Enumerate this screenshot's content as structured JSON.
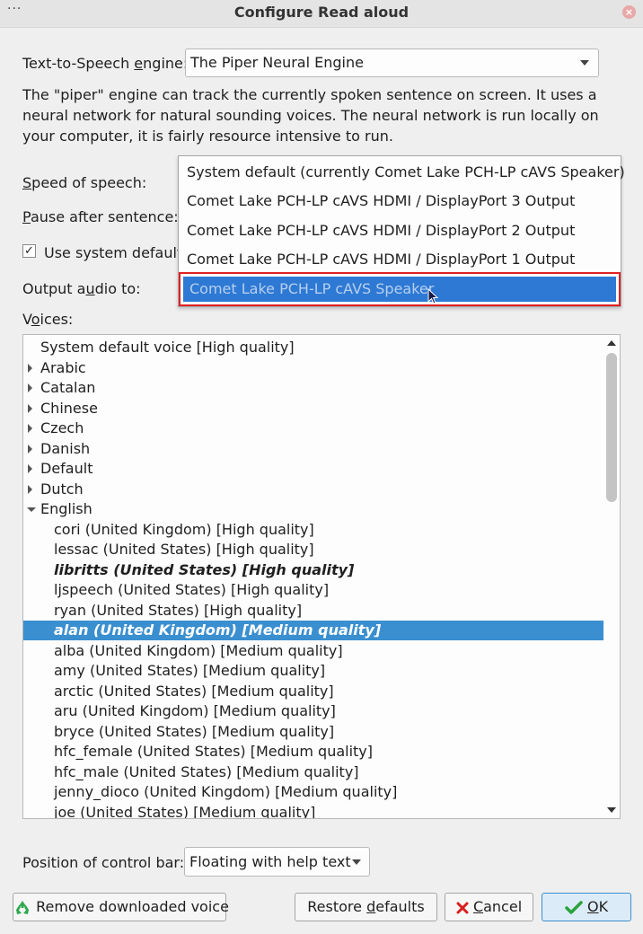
{
  "window": {
    "title": "Configure Read aloud",
    "menu_glyph": "···",
    "close_glyph": "×"
  },
  "engine": {
    "label": "Text-to-Speech engine:",
    "mnemonic": "e",
    "value": "The Piper Neural Engine"
  },
  "description": "The \"piper\" engine can track the currently spoken sentence on screen. It uses a neural network for natural sounding voices. The neural network is run locally on your computer, it is fairly resource intensive to run.",
  "speed": {
    "label": "Speed of speech:",
    "mnemonic": "S"
  },
  "pause": {
    "label": "Pause after sentence:",
    "mnemonic": "P"
  },
  "use_default": {
    "label": "Use system default",
    "checked": true,
    "check_glyph": "✓"
  },
  "output": {
    "label": "Output audio to:",
    "mnemonic": "u"
  },
  "output_options": [
    "System default (currently Comet Lake PCH-LP cAVS Speaker)",
    "Comet Lake PCH-LP cAVS HDMI / DisplayPort 3 Output",
    "Comet Lake PCH-LP cAVS HDMI / DisplayPort 2 Output",
    "Comet Lake PCH-LP cAVS HDMI / DisplayPort 1 Output",
    "Comet Lake PCH-LP cAVS Speaker"
  ],
  "output_highlighted_index": 4,
  "voices": {
    "label": "Voices:",
    "mnemonic": "o",
    "items": [
      {
        "text": "System default voice [High quality]",
        "type": "leaf0"
      },
      {
        "text": "Arabic",
        "type": "collapsed"
      },
      {
        "text": "Catalan",
        "type": "collapsed"
      },
      {
        "text": "Chinese",
        "type": "collapsed"
      },
      {
        "text": "Czech",
        "type": "collapsed"
      },
      {
        "text": "Danish",
        "type": "collapsed"
      },
      {
        "text": "Default",
        "type": "collapsed"
      },
      {
        "text": "Dutch",
        "type": "collapsed"
      },
      {
        "text": "English",
        "type": "expanded"
      },
      {
        "text": "cori (United Kingdom) [High quality]",
        "type": "child"
      },
      {
        "text": "lessac (United States) [High quality]",
        "type": "child"
      },
      {
        "text": "libritts (United States) [High quality]",
        "type": "child-bi"
      },
      {
        "text": "ljspeech (United States) [High quality]",
        "type": "child"
      },
      {
        "text": "ryan (United States) [High quality]",
        "type": "child"
      },
      {
        "text": "alan (United Kingdom) [Medium quality]",
        "type": "child-selected"
      },
      {
        "text": "alba (United Kingdom) [Medium quality]",
        "type": "child"
      },
      {
        "text": "amy (United States) [Medium quality]",
        "type": "child"
      },
      {
        "text": "arctic (United States) [Medium quality]",
        "type": "child"
      },
      {
        "text": "aru (United Kingdom) [Medium quality]",
        "type": "child"
      },
      {
        "text": "bryce (United States) [Medium quality]",
        "type": "child"
      },
      {
        "text": "hfc_female (United States) [Medium quality]",
        "type": "child"
      },
      {
        "text": "hfc_male (United States) [Medium quality]",
        "type": "child"
      },
      {
        "text": "jenny_dioco (United Kingdom) [Medium quality]",
        "type": "child"
      },
      {
        "text": "joe (United States) [Medium quality]",
        "type": "child"
      }
    ]
  },
  "control_bar": {
    "label": "Position of control bar:",
    "value": "Floating with help text"
  },
  "buttons": {
    "remove": "Remove downloaded voice",
    "restore": "Restore defaults",
    "cancel": "Cancel",
    "ok": "OK"
  },
  "colors": {
    "selection": "#3a8fd0",
    "popup_highlight": "#2d79d4",
    "focus_outline": "#e02020"
  }
}
